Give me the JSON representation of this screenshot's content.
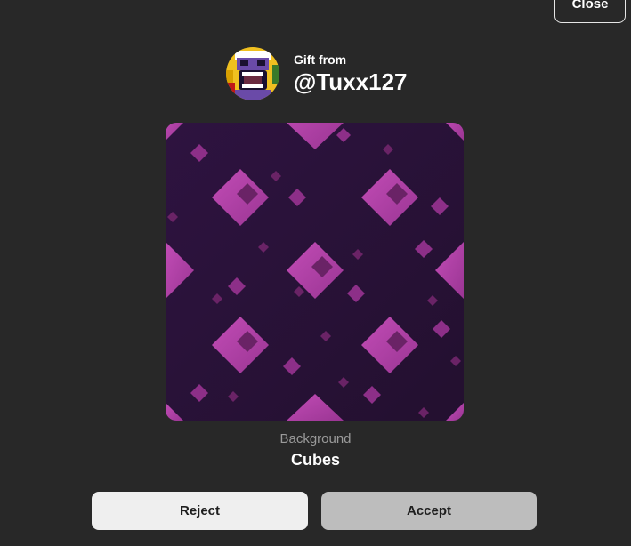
{
  "header": {
    "close_label": "Close"
  },
  "gift": {
    "from_label": "Gift from",
    "username": "@Tuxx127"
  },
  "item": {
    "type": "Background",
    "name": "Cubes"
  },
  "actions": {
    "reject_label": "Reject",
    "accept_label": "Accept"
  },
  "colors": {
    "page_background": "#282828",
    "reject_button": "#efefef",
    "accept_button": "#bdbdbd",
    "item_base": "#2a1236",
    "item_accent": "#a43d9c"
  }
}
